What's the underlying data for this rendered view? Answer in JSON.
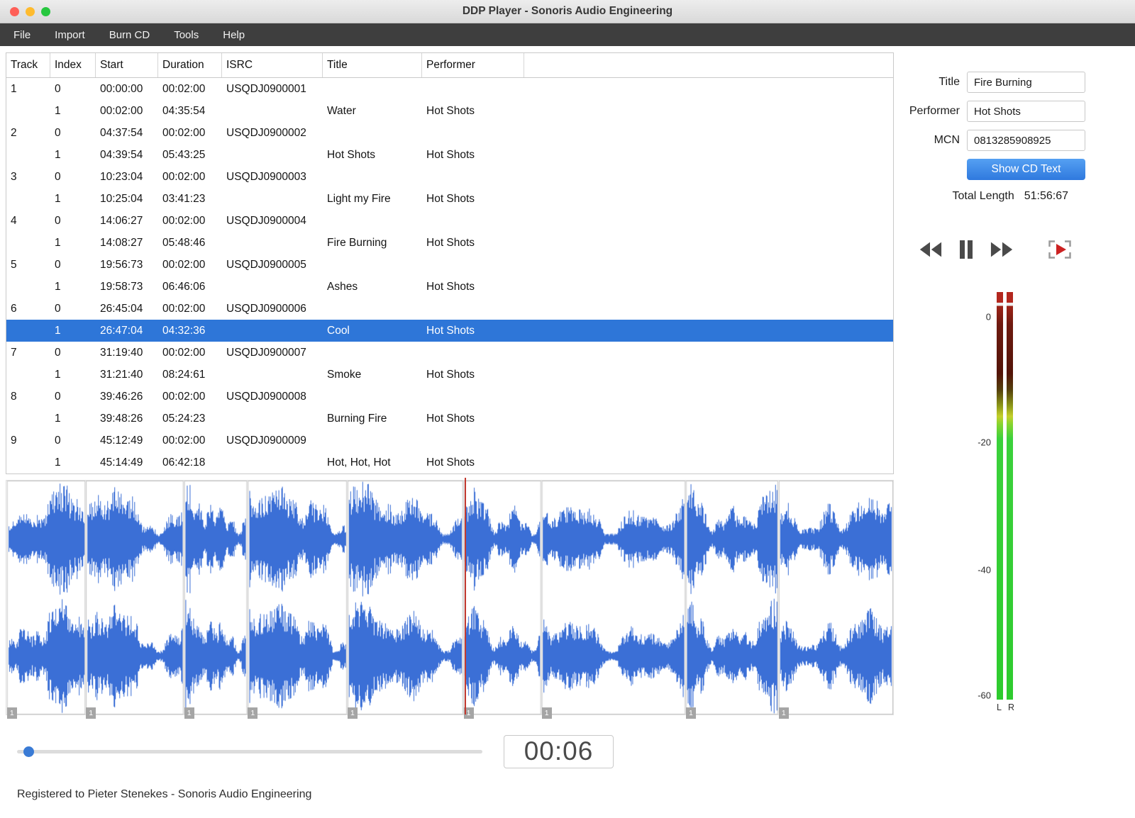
{
  "window": {
    "title": "DDP Player - Sonoris Audio Engineering"
  },
  "menu": {
    "items": [
      "File",
      "Import",
      "Burn CD",
      "Tools",
      "Help"
    ]
  },
  "table": {
    "columns": [
      "Track",
      "Index",
      "Start",
      "Duration",
      "ISRC",
      "Title",
      "Performer"
    ],
    "rows": [
      [
        "1",
        "0",
        "00:00:00",
        "00:02:00",
        "USQDJ0900001",
        "",
        ""
      ],
      [
        "",
        "1",
        "00:02:00",
        "04:35:54",
        "",
        "Water",
        "Hot Shots"
      ],
      [
        "2",
        "0",
        "04:37:54",
        "00:02:00",
        "USQDJ0900002",
        "",
        ""
      ],
      [
        "",
        "1",
        "04:39:54",
        "05:43:25",
        "",
        "Hot Shots",
        "Hot Shots"
      ],
      [
        "3",
        "0",
        "10:23:04",
        "00:02:00",
        "USQDJ0900003",
        "",
        ""
      ],
      [
        "",
        "1",
        "10:25:04",
        "03:41:23",
        "",
        "Light my Fire",
        "Hot Shots"
      ],
      [
        "4",
        "0",
        "14:06:27",
        "00:02:00",
        "USQDJ0900004",
        "",
        ""
      ],
      [
        "",
        "1",
        "14:08:27",
        "05:48:46",
        "",
        "Fire Burning",
        "Hot Shots"
      ],
      [
        "5",
        "0",
        "19:56:73",
        "00:02:00",
        "USQDJ0900005",
        "",
        ""
      ],
      [
        "",
        "1",
        "19:58:73",
        "06:46:06",
        "",
        "Ashes",
        "Hot Shots"
      ],
      [
        "6",
        "0",
        "26:45:04",
        "00:02:00",
        "USQDJ0900006",
        "",
        ""
      ],
      [
        "",
        "1",
        "26:47:04",
        "04:32:36",
        "",
        "Cool",
        "Hot Shots"
      ],
      [
        "7",
        "0",
        "31:19:40",
        "00:02:00",
        "USQDJ0900007",
        "",
        ""
      ],
      [
        "",
        "1",
        "31:21:40",
        "08:24:61",
        "",
        "Smoke",
        "Hot Shots"
      ],
      [
        "8",
        "0",
        "39:46:26",
        "00:02:00",
        "USQDJ0900008",
        "",
        ""
      ],
      [
        "",
        "1",
        "39:48:26",
        "05:24:23",
        "",
        "Burning Fire",
        "Hot Shots"
      ],
      [
        "9",
        "0",
        "45:12:49",
        "00:02:00",
        "USQDJ0900009",
        "",
        ""
      ],
      [
        "",
        "1",
        "45:14:49",
        "06:42:18",
        "",
        "Hot, Hot, Hot",
        "Hot Shots"
      ]
    ],
    "selected_row_index": 11
  },
  "side_panel": {
    "title_label": "Title",
    "title_value": "Fire Burning",
    "performer_label": "Performer",
    "performer_value": "Hot Shots",
    "mcn_label": "MCN",
    "mcn_value": "0813285908925",
    "show_cd_text_label": "Show CD Text",
    "total_length_label": "Total Length",
    "total_length_value": "51:56:67"
  },
  "meter": {
    "ticks": [
      {
        "label": "0",
        "pos": 6.1
      },
      {
        "label": "-20",
        "pos": 36.9
      },
      {
        "label": "-40",
        "pos": 68.2
      },
      {
        "label": "-60",
        "pos": 99.0
      }
    ],
    "channel_labels": [
      "L",
      "R"
    ]
  },
  "timeline": {
    "time_display": "00:06",
    "playhead_percent": 51.7,
    "slider_percent": 2.5,
    "segments": [
      {
        "label": "1",
        "start": 0.06,
        "width": 8.85
      },
      {
        "label": "1",
        "start": 8.97,
        "width": 11.02
      },
      {
        "label": "1",
        "start": 20.05,
        "width": 7.1
      },
      {
        "label": "1",
        "start": 27.22,
        "width": 11.18
      },
      {
        "label": "1",
        "start": 38.47,
        "width": 13.03
      },
      {
        "label": "1",
        "start": 51.56,
        "width": 8.74
      },
      {
        "label": "1",
        "start": 60.37,
        "width": 16.2
      },
      {
        "label": "1",
        "start": 76.63,
        "width": 10.4
      },
      {
        "label": "1",
        "start": 87.1,
        "width": 12.9
      }
    ]
  },
  "status_bar": {
    "text": "Registered to Pieter Stenekes - Sonoris Audio Engineering"
  },
  "colors": {
    "selection": "#2e76d8",
    "waveform": "#3b6fd6",
    "playhead": "#c23a30"
  }
}
